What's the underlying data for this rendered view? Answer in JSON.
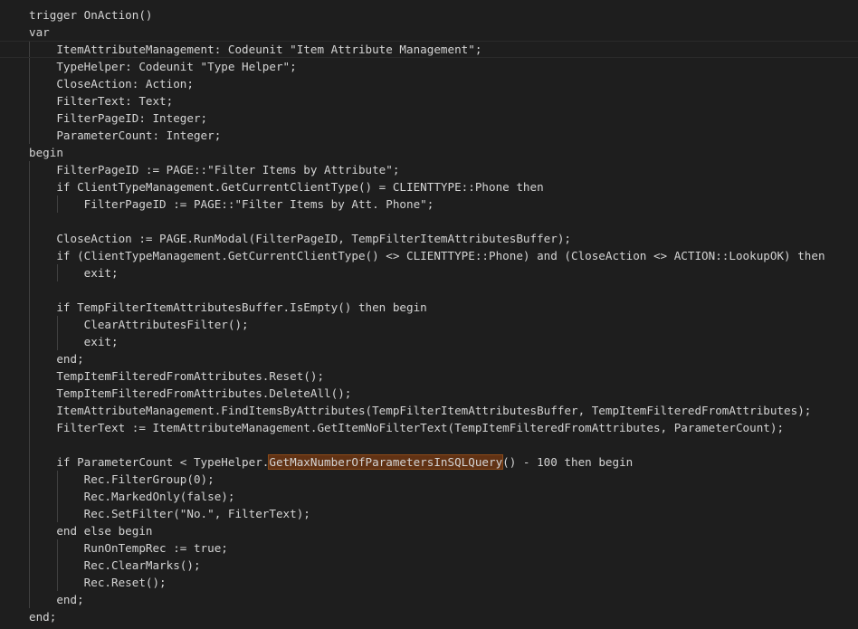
{
  "editor": {
    "lines": [
      {
        "indent": 0,
        "text": "trigger OnAction()"
      },
      {
        "indent": 0,
        "text": "var"
      },
      {
        "indent": 1,
        "text": "ItemAttributeManagement: Codeunit \"Item Attribute Management\";",
        "current": true
      },
      {
        "indent": 1,
        "text": "TypeHelper: Codeunit \"Type Helper\";"
      },
      {
        "indent": 1,
        "text": "CloseAction: Action;"
      },
      {
        "indent": 1,
        "text": "FilterText: Text;"
      },
      {
        "indent": 1,
        "text": "FilterPageID: Integer;"
      },
      {
        "indent": 1,
        "text": "ParameterCount: Integer;"
      },
      {
        "indent": 0,
        "text": "begin"
      },
      {
        "indent": 1,
        "text": "FilterPageID := PAGE::\"Filter Items by Attribute\";"
      },
      {
        "indent": 1,
        "text": "if ClientTypeManagement.GetCurrentClientType() = CLIENTTYPE::Phone then"
      },
      {
        "indent": 2,
        "text": "FilterPageID := PAGE::\"Filter Items by Att. Phone\";"
      },
      {
        "indent": 1,
        "text": ""
      },
      {
        "indent": 1,
        "text": "CloseAction := PAGE.RunModal(FilterPageID, TempFilterItemAttributesBuffer);"
      },
      {
        "indent": 1,
        "text": "if (ClientTypeManagement.GetCurrentClientType() <> CLIENTTYPE::Phone) and (CloseAction <> ACTION::LookupOK) then"
      },
      {
        "indent": 2,
        "text": "exit;"
      },
      {
        "indent": 1,
        "text": ""
      },
      {
        "indent": 1,
        "text": "if TempFilterItemAttributesBuffer.IsEmpty() then begin"
      },
      {
        "indent": 2,
        "text": "ClearAttributesFilter();"
      },
      {
        "indent": 2,
        "text": "exit;"
      },
      {
        "indent": 1,
        "text": "end;"
      },
      {
        "indent": 1,
        "text": "TempItemFilteredFromAttributes.Reset();"
      },
      {
        "indent": 1,
        "text": "TempItemFilteredFromAttributes.DeleteAll();"
      },
      {
        "indent": 1,
        "text": "ItemAttributeManagement.FindItemsByAttributes(TempFilterItemAttributesBuffer, TempItemFilteredFromAttributes);"
      },
      {
        "indent": 1,
        "text": "FilterText := ItemAttributeManagement.GetItemNoFilterText(TempItemFilteredFromAttributes, ParameterCount);"
      },
      {
        "indent": 1,
        "text": ""
      },
      {
        "indent": 1,
        "text": "if ParameterCount < TypeHelper.",
        "highlight": "GetMaxNumberOfParametersInSQLQuery",
        "after": "() - 100 then begin"
      },
      {
        "indent": 2,
        "text": "Rec.FilterGroup(0);"
      },
      {
        "indent": 2,
        "text": "Rec.MarkedOnly(false);"
      },
      {
        "indent": 2,
        "text": "Rec.SetFilter(\"No.\", FilterText);"
      },
      {
        "indent": 1,
        "text": "end else begin"
      },
      {
        "indent": 2,
        "text": "RunOnTempRec := true;"
      },
      {
        "indent": 2,
        "text": "Rec.ClearMarks();"
      },
      {
        "indent": 2,
        "text": "Rec.Reset();"
      },
      {
        "indent": 1,
        "text": "end;"
      },
      {
        "indent": 0,
        "text": "end;"
      }
    ]
  }
}
